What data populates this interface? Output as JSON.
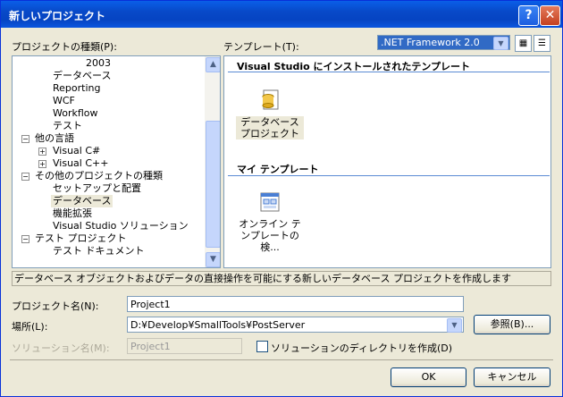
{
  "window": {
    "title": "新しいプロジェクト",
    "help": "?",
    "close": "✕"
  },
  "project_types": {
    "label": "プロジェクトの種類(P):",
    "items": [
      "2003",
      "データベース",
      "Reporting",
      "WCF",
      "Workflow",
      "テスト",
      "他の言語",
      "Visual C#",
      "Visual C++",
      "その他のプロジェクトの種類",
      "セットアップと配置",
      "データベース",
      "機能拡張",
      "Visual Studio ソリューション",
      "テスト プロジェクト",
      "テスト ドキュメント"
    ],
    "selected": "データベース"
  },
  "templates": {
    "label": "テンプレート(T):",
    "framework": ".NET Framework 2.0",
    "installed_header": "Visual Studio にインストールされたテンプレート",
    "installed": [
      {
        "label": "データベース プロジェクト",
        "icon": "database-project-icon"
      }
    ],
    "my_header": "マイ テンプレート",
    "my": [
      {
        "label": "オンライン テンプレートの検...",
        "icon": "online-template-search-icon"
      }
    ]
  },
  "description": "データベース オブジェクトおよびデータの直接操作を可能にする新しいデータベース プロジェクトを作成します",
  "form": {
    "name_label": "プロジェクト名(N):",
    "name_value": "Project1",
    "location_label": "場所(L):",
    "location_value": "D:¥Develop¥SmallTools¥PostServer",
    "browse": "参照(B)...",
    "solution_label": "ソリューション名(M):",
    "solution_value": "Project1",
    "create_dir": "ソリューションのディレクトリを作成(D)"
  },
  "buttons": {
    "ok": "OK",
    "cancel": "キャンセル"
  }
}
